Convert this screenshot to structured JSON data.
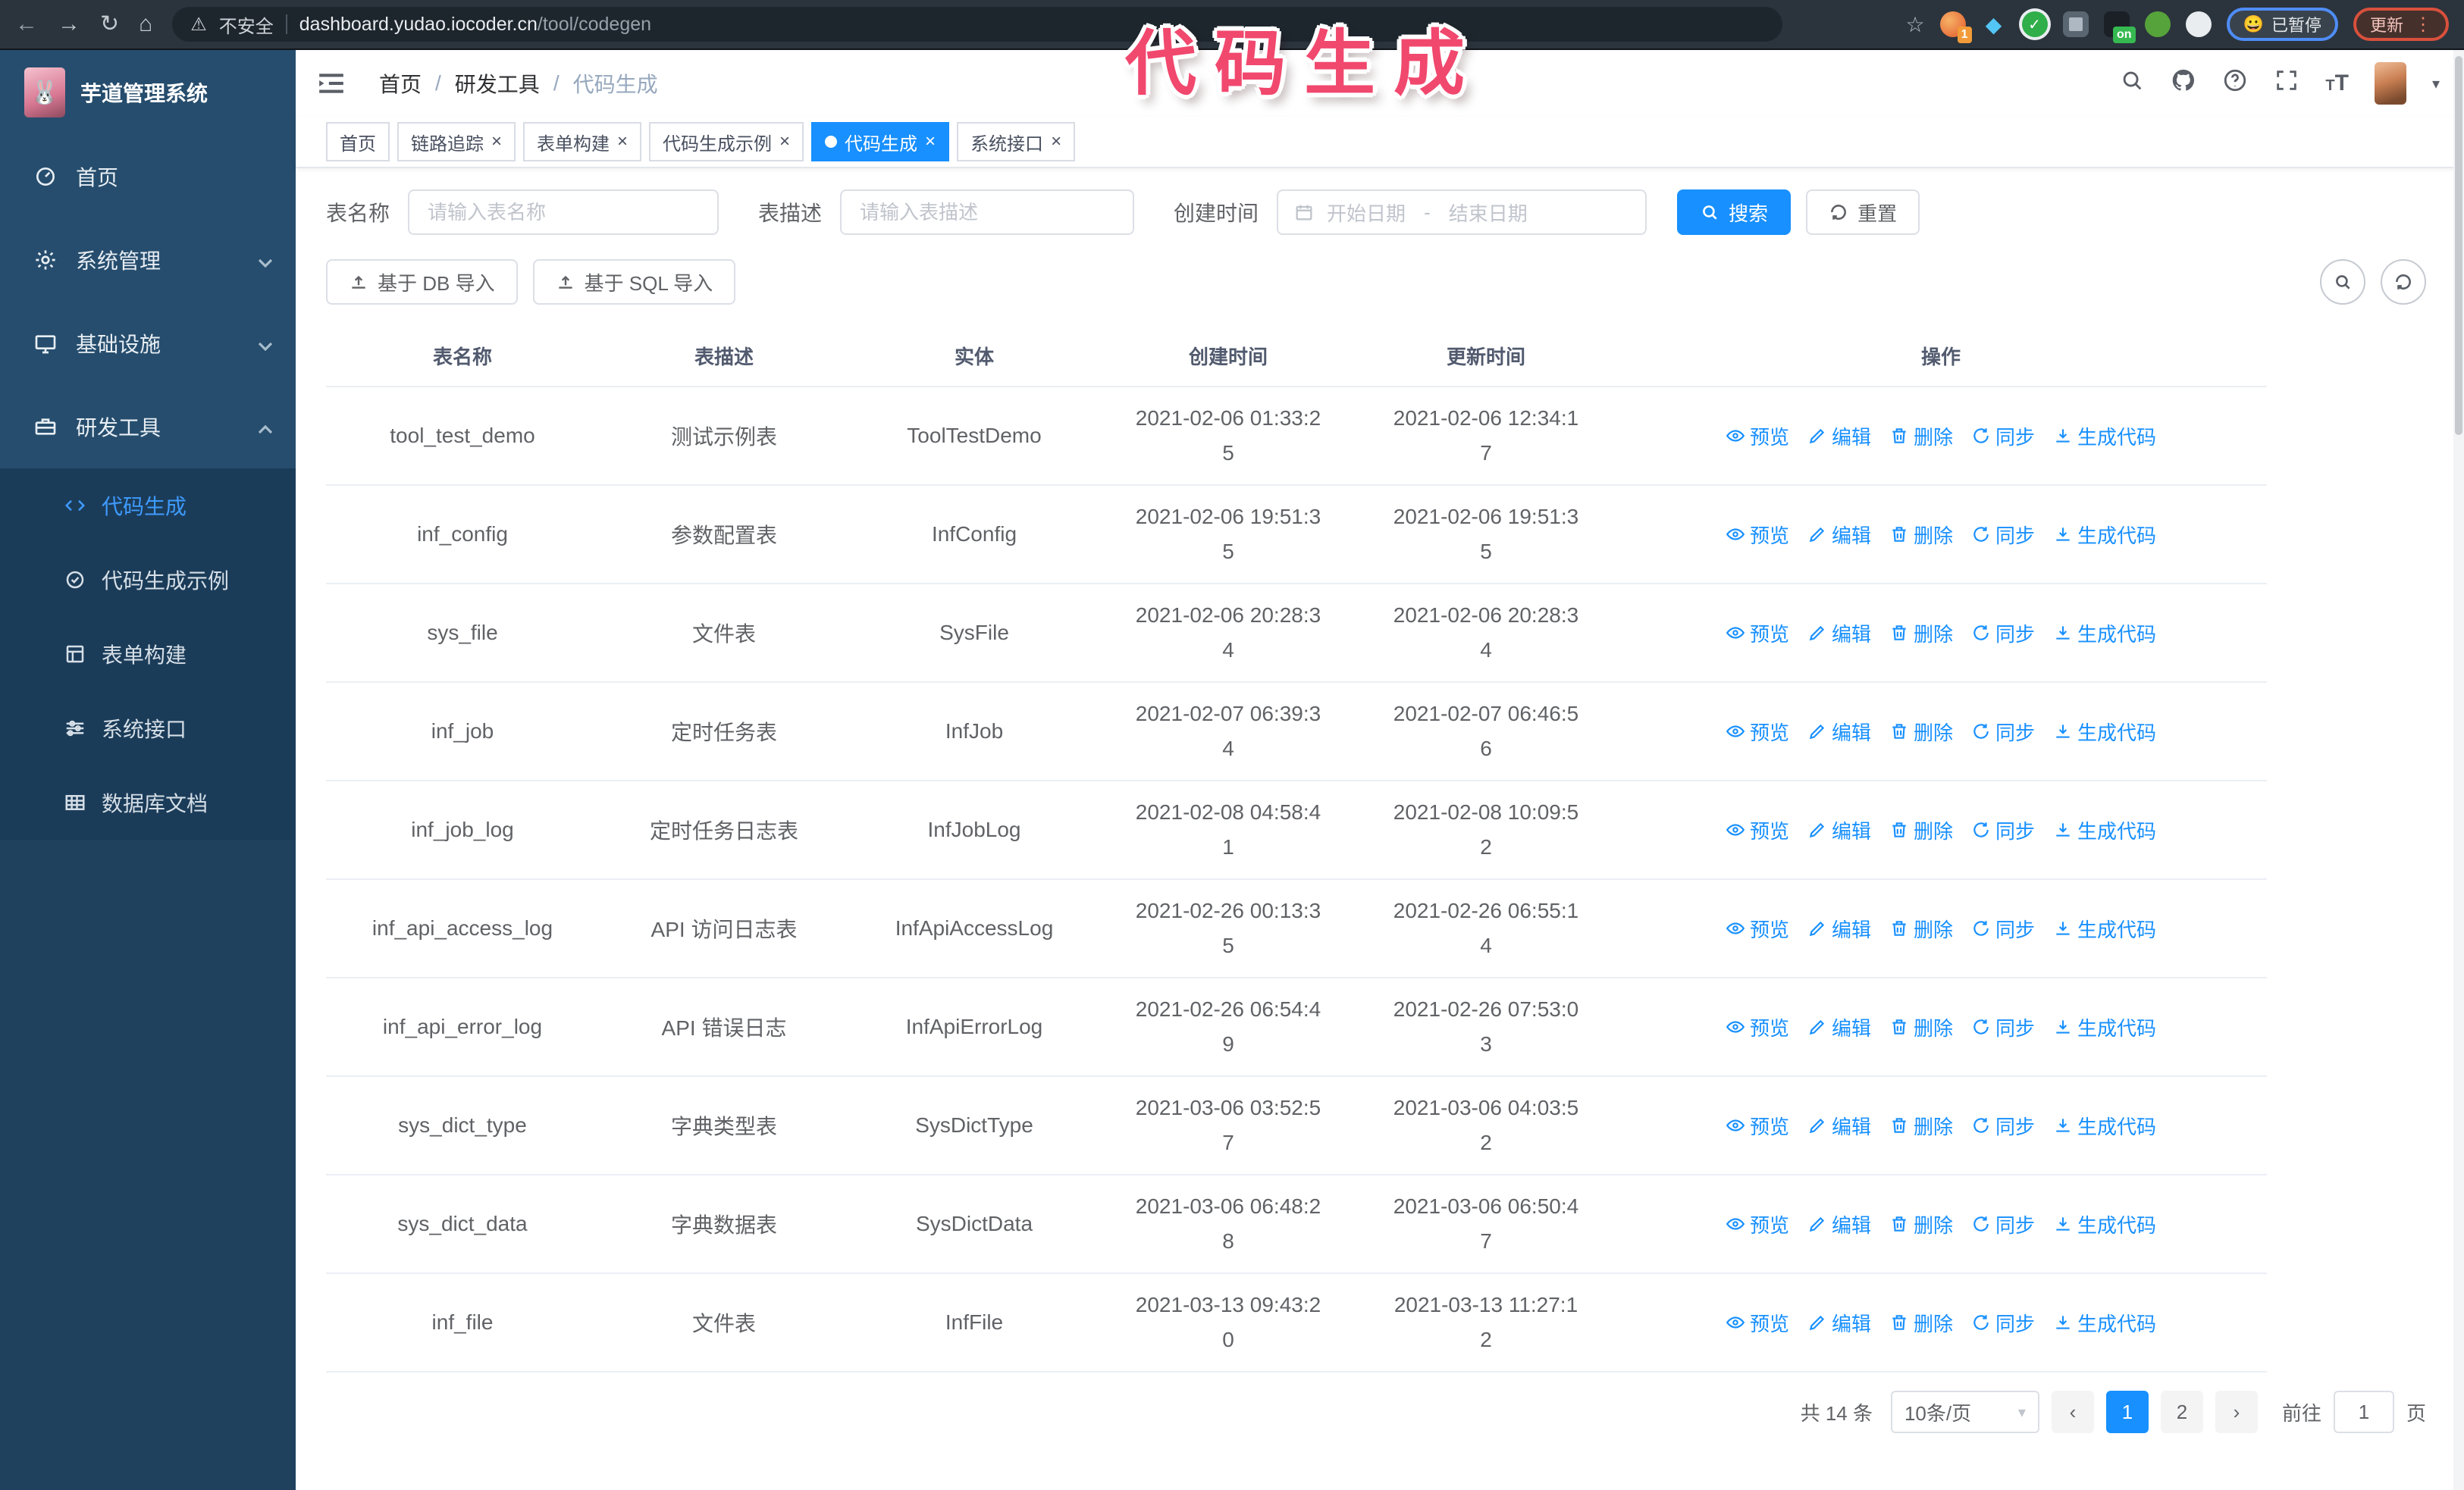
{
  "browser": {
    "security_label": "不安全",
    "url_host": "dashboard.yudao.iocoder.cn",
    "url_path": "/tool/codegen",
    "paused_label": "已暂停",
    "update_label": "更新",
    "extension_badge_count": "1",
    "extension_badge_on": "on",
    "nav": {
      "back": "←",
      "forward": "→",
      "reload": "↻",
      "home": "⌂",
      "warning": "⚠",
      "star": "☆",
      "dots": "⋮"
    }
  },
  "annotation": "代码生成",
  "app": {
    "title": "芋道管理系统",
    "logo_emoji": "🐰"
  },
  "breadcrumb": {
    "items": [
      "首页",
      "研发工具",
      "代码生成"
    ],
    "separator": "/"
  },
  "tabs": {
    "close_glyph": "×",
    "items": [
      {
        "label": "首页",
        "closable": false,
        "active": false
      },
      {
        "label": "链路追踪",
        "closable": true,
        "active": false
      },
      {
        "label": "表单构建",
        "closable": true,
        "active": false
      },
      {
        "label": "代码生成示例",
        "closable": true,
        "active": false
      },
      {
        "label": "代码生成",
        "closable": true,
        "active": true
      },
      {
        "label": "系统接口",
        "closable": true,
        "active": false
      }
    ]
  },
  "sidebar": {
    "items": [
      {
        "label": "首页",
        "icon": "dashboard",
        "chevron": null,
        "active": false
      },
      {
        "label": "系统管理",
        "icon": "gear",
        "chevron": "down",
        "active": false
      },
      {
        "label": "基础设施",
        "icon": "monitor",
        "chevron": "down",
        "active": false
      },
      {
        "label": "研发工具",
        "icon": "toolbox",
        "chevron": "up",
        "active": true
      }
    ],
    "subitems": [
      {
        "label": "代码生成",
        "icon": "code",
        "active": true
      },
      {
        "label": "代码生成示例",
        "icon": "badge",
        "active": false
      },
      {
        "label": "表单构建",
        "icon": "form",
        "active": false
      },
      {
        "label": "系统接口",
        "icon": "sliders",
        "active": false
      },
      {
        "label": "数据库文档",
        "icon": "dbdoc",
        "active": false
      }
    ]
  },
  "search_form": {
    "name_label": "表名称",
    "name_placeholder": "请输入表名称",
    "desc_label": "表描述",
    "desc_placeholder": "请输入表描述",
    "time_label": "创建时间",
    "start_placeholder": "开始日期",
    "range_separator": "-",
    "end_placeholder": "结束日期",
    "search_button": "搜索",
    "reset_button": "重置"
  },
  "toolbar": {
    "import_db": "基于 DB 导入",
    "import_sql": "基于 SQL 导入"
  },
  "table": {
    "columns": [
      "表名称",
      "表描述",
      "实体",
      "创建时间",
      "更新时间",
      "操作"
    ],
    "action_labels": [
      "预览",
      "编辑",
      "删除",
      "同步",
      "生成代码"
    ],
    "rows": [
      {
        "name": "tool_test_demo",
        "desc": "测试示例表",
        "entity": "ToolTestDemo",
        "created": "2021-02-06 01:33:25",
        "updated": "2021-02-06 12:34:17"
      },
      {
        "name": "inf_config",
        "desc": "参数配置表",
        "entity": "InfConfig",
        "created": "2021-02-06 19:51:35",
        "updated": "2021-02-06 19:51:35"
      },
      {
        "name": "sys_file",
        "desc": "文件表",
        "entity": "SysFile",
        "created": "2021-02-06 20:28:34",
        "updated": "2021-02-06 20:28:34"
      },
      {
        "name": "inf_job",
        "desc": "定时任务表",
        "entity": "InfJob",
        "created": "2021-02-07 06:39:34",
        "updated": "2021-02-07 06:46:56"
      },
      {
        "name": "inf_job_log",
        "desc": "定时任务日志表",
        "entity": "InfJobLog",
        "created": "2021-02-08 04:58:41",
        "updated": "2021-02-08 10:09:52"
      },
      {
        "name": "inf_api_access_log",
        "desc": "API 访问日志表",
        "entity": "InfApiAccessLog",
        "created": "2021-02-26 00:13:35",
        "updated": "2021-02-26 06:55:14"
      },
      {
        "name": "inf_api_error_log",
        "desc": "API 错误日志",
        "entity": "InfApiErrorLog",
        "created": "2021-02-26 06:54:49",
        "updated": "2021-02-26 07:53:03"
      },
      {
        "name": "sys_dict_type",
        "desc": "字典类型表",
        "entity": "SysDictType",
        "created": "2021-03-06 03:52:57",
        "updated": "2021-03-06 04:03:52"
      },
      {
        "name": "sys_dict_data",
        "desc": "字典数据表",
        "entity": "SysDictData",
        "created": "2021-03-06 06:48:28",
        "updated": "2021-03-06 06:50:47"
      },
      {
        "name": "inf_file",
        "desc": "文件表",
        "entity": "InfFile",
        "created": "2021-03-13 09:43:20",
        "updated": "2021-03-13 11:27:12"
      }
    ]
  },
  "pagination": {
    "total": "共 14 条",
    "page_size": "10条/页",
    "prev_glyph": "‹",
    "next_glyph": "›",
    "caret_glyph": "▾",
    "pages": [
      {
        "label": "1",
        "active": true
      },
      {
        "label": "2",
        "active": false
      }
    ],
    "jump_prefix": "前往",
    "jump_value": "1",
    "jump_suffix": "页"
  },
  "colors": {
    "accent": "#1890ff",
    "annotation": "#f1486e",
    "sidebar": "#264d6d",
    "submenu": "#1b3c59"
  }
}
